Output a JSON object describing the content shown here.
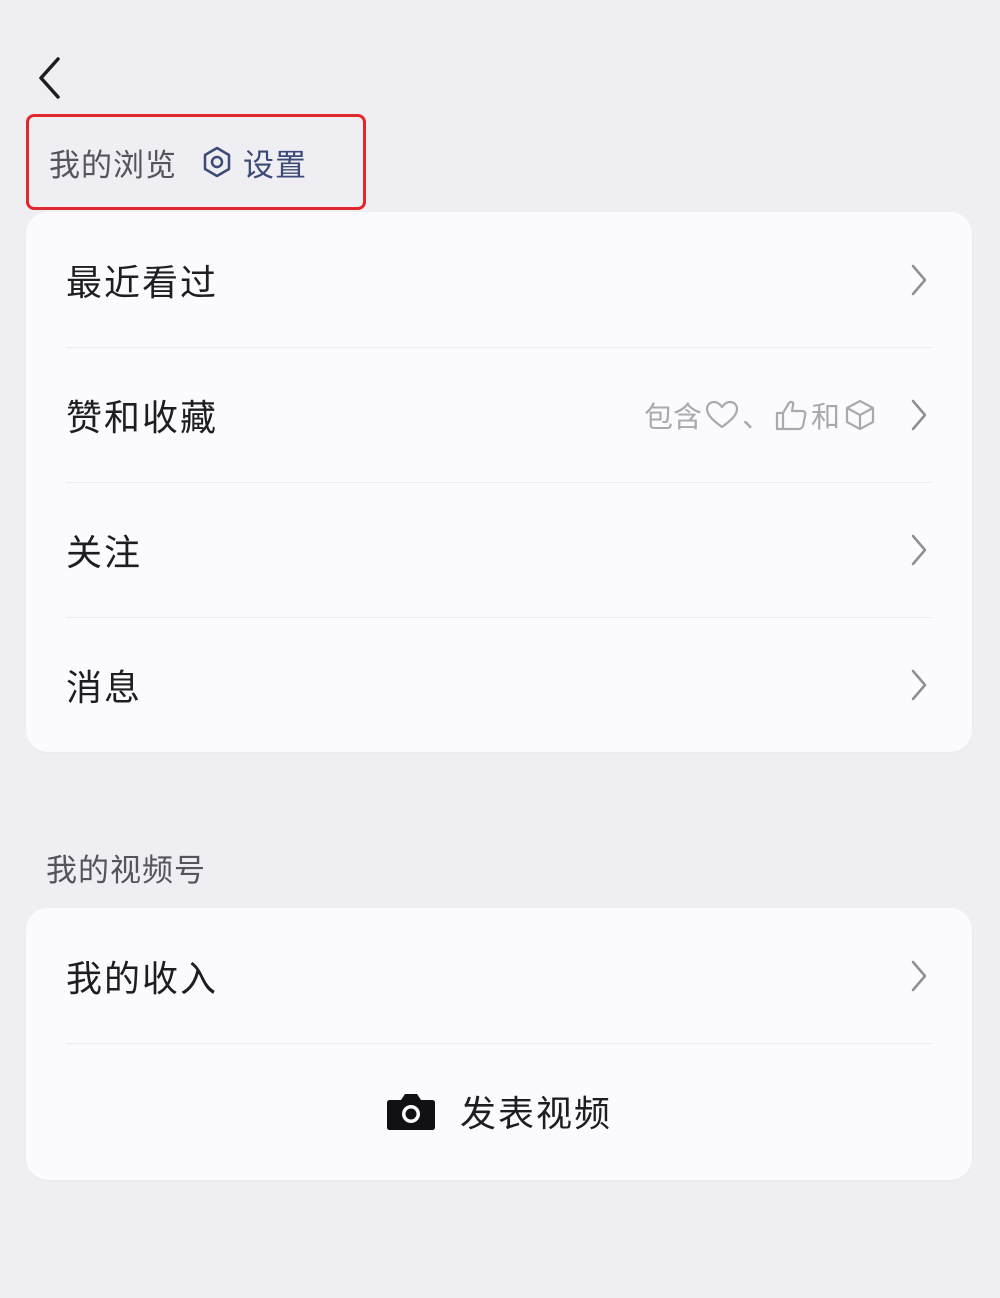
{
  "nav": {
    "back_icon": "chevron-left-icon"
  },
  "browse": {
    "title": "我的浏览",
    "settings_icon": "settings-ring-icon",
    "settings_label": "设置",
    "items": [
      {
        "label": "最近看过"
      },
      {
        "label": "赞和收藏",
        "hint_prefix": "包含",
        "hint_sep": "、",
        "hint_mid": "和",
        "hint_icons": [
          "heart-icon",
          "thumbs-up-icon",
          "cube-icon"
        ]
      },
      {
        "label": "关注"
      },
      {
        "label": "消息"
      }
    ]
  },
  "channels": {
    "title": "我的视频号",
    "items": [
      {
        "label": "我的收入"
      }
    ],
    "publish_label": "发表视频",
    "publish_icon": "camera-icon"
  },
  "colors": {
    "highlight_border": "#e0292f",
    "background": "#efeff3",
    "card": "#fbfbfd"
  }
}
